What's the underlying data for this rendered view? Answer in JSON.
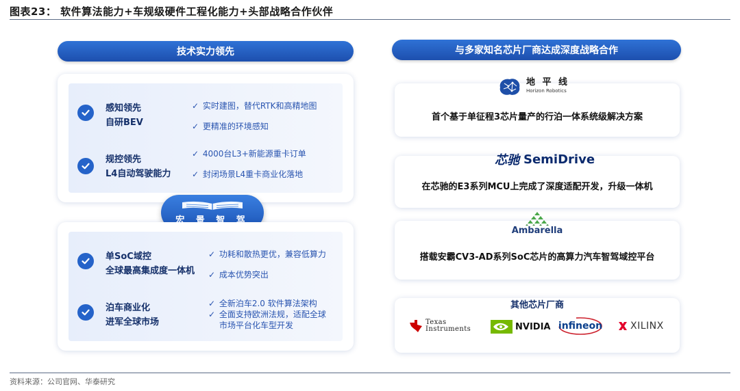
{
  "figure": {
    "title": "图表23：  软件算法能力+车规级硬件工程化能力+头部战略合作伙伴",
    "source": "资料来源：公司官网、华泰研究"
  },
  "left": {
    "header": "技术实力领先",
    "brand_name": "宏 景 智 驾",
    "top_card": {
      "features": [
        {
          "title_line1": "感知领先",
          "title_line2": "自研BEV",
          "bullets": [
            "实时建图，替代RTK和高精地图",
            "更精准的环境感知"
          ]
        },
        {
          "title_line1": "规控领先",
          "title_line2": "L4自动驾驶能力",
          "bullets": [
            "4000台L3+新能源重卡订单",
            "封闭场景L4重卡商业化落地"
          ]
        }
      ]
    },
    "bottom_card": {
      "features": [
        {
          "title_line1": "单SoC域控",
          "title_line2": "全球最高集成度一体机",
          "bullets": [
            "功耗和散热更优，兼容低算力",
            "成本优势突出"
          ]
        },
        {
          "title_line1": "泊车商业化",
          "title_line2": "进军全球市场",
          "bullets": [
            "全新泊车2.0 软件算法架构",
            "全面支持欧洲法规，适配全球",
            "市场平台化车型开发"
          ]
        }
      ]
    }
  },
  "right": {
    "header": "与多家知名芯片厂商达成深度战略合作",
    "partners": [
      {
        "logo_cn": "地 平 线",
        "logo_en": "Horizon Robotics",
        "desc": "首个基于单征程3芯片量产的行泊一体系统级解决方案"
      },
      {
        "logo_cn": "芯驰",
        "logo_en": "SemiDrive",
        "desc": "在芯驰的E3系列MCU上完成了深度适配开发，升级一体机"
      },
      {
        "logo_en": "Ambarella",
        "desc": "搭载安霸CV3-AD系列SoC芯片的高算力汽车智驾域控平台"
      }
    ],
    "others": {
      "title": "其他芯片厂商",
      "logos": [
        {
          "line1": "Texas",
          "line2": "Instruments"
        },
        {
          "name": "NVIDIA"
        },
        {
          "name": "infineon"
        },
        {
          "name": "XILINX"
        }
      ]
    }
  },
  "colors": {
    "accent": "#2563c9",
    "pill_top": "#2f72d6",
    "pill_bottom": "#1d4fae",
    "ti_red": "#cc0000",
    "nvidia_green": "#76b900",
    "infineon_blue": "#0a3f8c",
    "xilinx_red": "#e3002b"
  }
}
